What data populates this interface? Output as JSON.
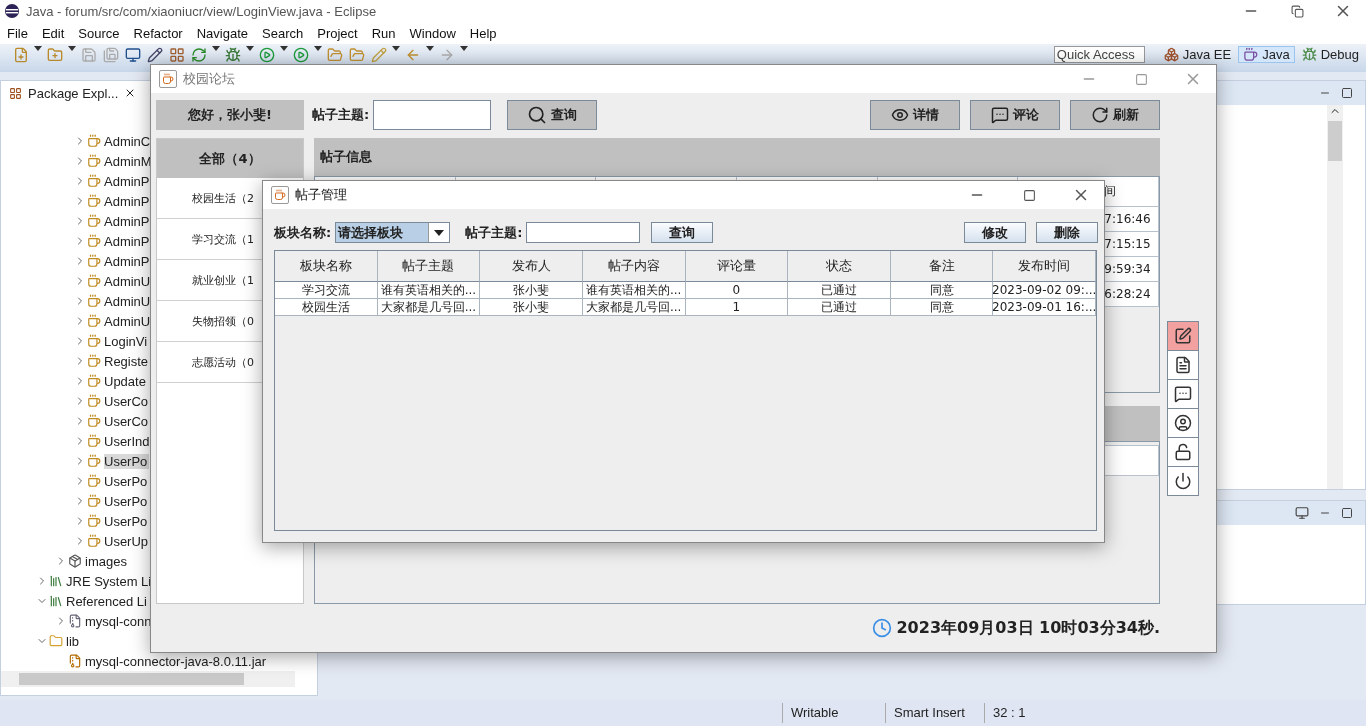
{
  "eclipse": {
    "title": "Java - forum/src/com/xiaoniucr/view/LoginView.java - Eclipse",
    "menu": [
      "File",
      "Edit",
      "Source",
      "Refactor",
      "Navigate",
      "Search",
      "Project",
      "Run",
      "Window",
      "Help"
    ],
    "quick_access": {
      "placeholder": "Quick Access"
    },
    "perspectives": [
      {
        "label": "Java EE",
        "kind": "javaee",
        "selected": false
      },
      {
        "label": "Java",
        "kind": "java",
        "selected": true
      },
      {
        "label": "Debug",
        "kind": "debug",
        "selected": false
      }
    ],
    "package_explorer": {
      "tab": "Package Expl...",
      "tree": [
        {
          "children": [
            {
              "children": [
                {
                  "children": [
                    {
                      "label": "AdminC",
                      "kind": "java",
                      "expanded": false,
                      "selected": false
                    },
                    {
                      "label": "AdminM",
                      "kind": "java",
                      "expanded": false,
                      "selected": false
                    },
                    {
                      "label": "AdminP",
                      "kind": "java",
                      "expanded": false,
                      "selected": false
                    },
                    {
                      "label": "AdminP",
                      "kind": "java",
                      "expanded": false,
                      "selected": false
                    },
                    {
                      "label": "AdminP",
                      "kind": "java",
                      "expanded": false,
                      "selected": false
                    },
                    {
                      "label": "AdminP",
                      "kind": "java",
                      "expanded": false,
                      "selected": false
                    },
                    {
                      "label": "AdminP",
                      "kind": "java",
                      "expanded": false,
                      "selected": false
                    },
                    {
                      "label": "AdminU",
                      "kind": "java",
                      "expanded": false,
                      "selected": false
                    },
                    {
                      "label": "AdminU",
                      "kind": "java",
                      "expanded": false,
                      "selected": false
                    },
                    {
                      "label": "AdminU",
                      "kind": "java",
                      "expanded": false,
                      "selected": false
                    },
                    {
                      "label": "LoginVi",
                      "kind": "java",
                      "expanded": false,
                      "selected": false
                    },
                    {
                      "label": "Registe",
                      "kind": "java",
                      "expanded": false,
                      "selected": false
                    },
                    {
                      "label": "Update",
                      "kind": "java",
                      "expanded": false,
                      "selected": false
                    },
                    {
                      "label": "UserCo",
                      "kind": "java",
                      "expanded": false,
                      "selected": false
                    },
                    {
                      "label": "UserCo",
                      "kind": "java",
                      "expanded": false,
                      "selected": false
                    },
                    {
                      "label": "UserInd",
                      "kind": "java",
                      "expanded": false,
                      "selected": false
                    },
                    {
                      "label": "UserPo",
                      "kind": "java",
                      "expanded": false,
                      "selected": true
                    },
                    {
                      "label": "UserPo",
                      "kind": "java",
                      "expanded": false,
                      "selected": false
                    },
                    {
                      "label": "UserPo",
                      "kind": "java",
                      "expanded": false,
                      "selected": false
                    },
                    {
                      "label": "UserPo",
                      "kind": "java",
                      "expanded": false,
                      "selected": false
                    },
                    {
                      "label": "UserUp",
                      "kind": "java",
                      "expanded": false,
                      "selected": false
                    }
                  ]
                },
                {
                  "label": "images",
                  "kind": "package",
                  "expanded": false,
                  "selected": false
                }
              ]
            },
            {
              "label": "JRE System Li",
              "kind": "library",
              "expanded": false,
              "selected": false
            },
            {
              "label": "Referenced Li",
              "kind": "library",
              "expanded": true,
              "selected": false,
              "children": [
                {
                  "label": "mysql-conn",
                  "kind": "jar",
                  "expanded": false,
                  "selected": false
                }
              ]
            },
            {
              "label": "lib",
              "kind": "folder",
              "expanded": true,
              "selected": false,
              "children": [
                {
                  "label": "mysql-connector-java-8.0.11.jar",
                  "kind": "jarfile",
                  "selected": false
                }
              ]
            }
          ]
        }
      ]
    },
    "status_bar": [
      "Writable",
      "Smart Insert",
      "32 : 1"
    ]
  },
  "forum_window": {
    "title": "校园论坛",
    "greeting": "您好，张小斐!",
    "search": {
      "label": "帖子主题:",
      "button": "查询"
    },
    "actions": [
      {
        "kind": "details",
        "label": "详情"
      },
      {
        "kind": "comment",
        "label": "评论"
      },
      {
        "kind": "refresh",
        "label": "刷新"
      }
    ],
    "categories": {
      "header": "全部（4）",
      "items": [
        "校园生活（2",
        "学习交流（1",
        "就业创业（1",
        "失物招领（0",
        "志愿活动（0"
      ]
    },
    "posts_panel": {
      "title": "帖子信息",
      "visible_column": {
        "header": "间",
        "cells": [
          "7:16:46",
          "7:15:15",
          "9:59:34",
          "6:28:24"
        ]
      }
    },
    "side_tools": [
      {
        "kind": "edit",
        "selected": true
      },
      {
        "kind": "document",
        "selected": false
      },
      {
        "kind": "comment",
        "selected": false
      },
      {
        "kind": "user",
        "selected": false
      },
      {
        "kind": "unlock",
        "selected": false
      },
      {
        "kind": "power",
        "selected": false
      }
    ],
    "clock": "2023年09月03日 10时03分34秒."
  },
  "post_dialog": {
    "title": "帖子管理",
    "section_label": "板块名称:",
    "section_value": "请选择板块",
    "topic_label": "帖子主题:",
    "query_button": "查询",
    "buttons": [
      "修改",
      "删除"
    ],
    "table": {
      "columns": [
        "板块名称",
        "帖子主题",
        "发布人",
        "帖子内容",
        "评论量",
        "状态",
        "备注",
        "发布时间"
      ],
      "rows": [
        [
          "学习交流",
          "谁有英语相关的...",
          "张小斐",
          "谁有英语相关的...",
          "0",
          "已通过",
          "同意",
          "2023-09-02 09:..."
        ],
        [
          "校园生活",
          "大家都是几号回...",
          "张小斐",
          "大家都是几号回...",
          "1",
          "已通过",
          "同意",
          "2023-09-01 16:..."
        ]
      ]
    }
  }
}
